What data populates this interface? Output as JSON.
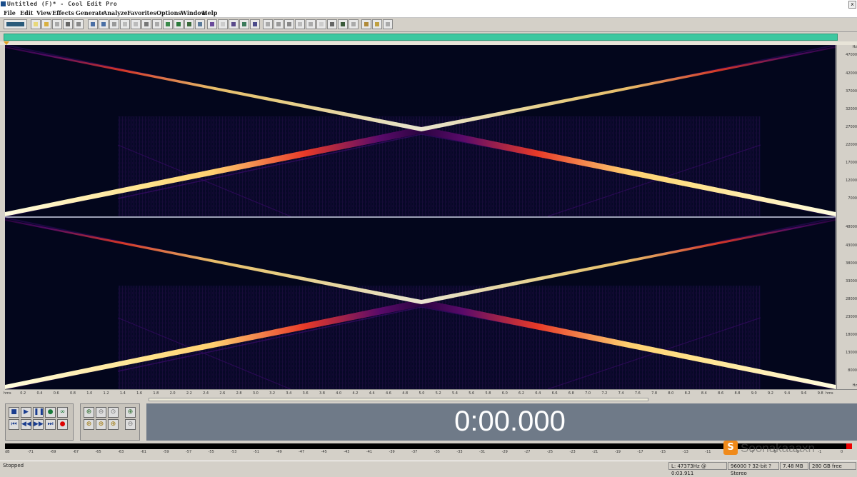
{
  "window": {
    "title": "Untitled (F)* - Cool Edit Pro"
  },
  "menu": [
    "File",
    "Edit",
    "View",
    "Effects",
    "Generate",
    "Analyze",
    "Favorites",
    "Options",
    "Window",
    "Help"
  ],
  "toolbar_icons": [
    "open-icon",
    "save-icon",
    "save-as-icon",
    "close-icon",
    "undo-icon",
    "redo-icon",
    "cut-icon",
    "copy-icon",
    "paste-icon",
    "mix-paste-icon",
    "crop-icon",
    "silence-icon",
    "spectral-view-icon",
    "waveform-view-icon",
    "settings-icon",
    "help-icon"
  ],
  "spectrogram": {
    "channels": 2,
    "freq_axis_unit": "Hz",
    "freq_ticks_top": [
      "47000",
      "42000",
      "37000",
      "32000",
      "27000",
      "22000",
      "17000",
      "12000",
      "7000",
      "Hz"
    ],
    "freq_ticks_bottom": [
      "48000",
      "43000",
      "38000",
      "33000",
      "28000",
      "23000",
      "18000",
      "13000",
      "8000",
      "Hz"
    ],
    "time_ticks": [
      "hms",
      "0.2",
      "0.4",
      "0.6",
      "0.8",
      "1.0",
      "1.2",
      "1.4",
      "1.6",
      "1.8",
      "2.0",
      "2.2",
      "2.4",
      "2.6",
      "2.8",
      "3.0",
      "3.2",
      "3.4",
      "3.6",
      "3.8",
      "4.0",
      "4.2",
      "4.4",
      "4.6",
      "4.8",
      "5.0",
      "5.2",
      "5.4",
      "5.6",
      "5.8",
      "6.0",
      "6.2",
      "6.4",
      "6.6",
      "6.8",
      "7.0",
      "7.2",
      "7.4",
      "7.6",
      "7.8",
      "8.0",
      "8.2",
      "8.4",
      "8.6",
      "8.8",
      "9.0",
      "9.2",
      "9.4",
      "9.6",
      "9.8",
      "hms"
    ]
  },
  "transport": {
    "buttons": [
      "stop",
      "play",
      "pause",
      "play-to-end",
      "loop",
      "go-to-start",
      "rewind",
      "fast-forward",
      "go-to-end",
      "record"
    ]
  },
  "zoom": {
    "buttons": [
      "zoom-in-horizontal",
      "zoom-out-horizontal",
      "zoom-full-horizontal",
      "zoom-in-vertical",
      "zoom-out-vertical",
      "zoom-full-vertical",
      "zoom-selection",
      "zoom-left",
      "zoom-right"
    ]
  },
  "time_display": "0:00.000",
  "meter_scale": [
    "dB",
    "-71",
    "-69",
    "-67",
    "-65",
    "-63",
    "-61",
    "-59",
    "-57",
    "-55",
    "-53",
    "-51",
    "-49",
    "-47",
    "-45",
    "-43",
    "-41",
    "-39",
    "-37",
    "-35",
    "-33",
    "-31",
    "-29",
    "-27",
    "-25",
    "-23",
    "-21",
    "-19",
    "-17",
    "-15",
    "-13",
    "-11",
    "-9",
    "-7",
    "-5",
    "-3",
    "-1",
    "0"
  ],
  "watermark": {
    "text": "Soonakaaaxn"
  },
  "status": {
    "state": "Stopped",
    "cursor": "L: 47373Hz @ 0:03.911",
    "format": "96000 ? 32-bit ? Stereo",
    "size": "7.48 MB",
    "free": "280 GB free"
  }
}
